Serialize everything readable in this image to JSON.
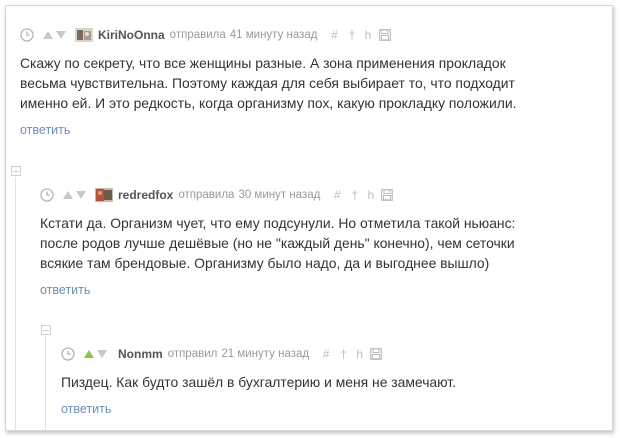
{
  "colors": {
    "link": "#6b8fb5",
    "vote_up_active": "#8cc152",
    "vote_inactive": "#c8c8c8",
    "meta": "#9a9a9a",
    "text": "#333333"
  },
  "icons": {
    "clock": "clock-icon",
    "vote_up": "triangle-up-icon",
    "vote_down": "triangle-down-icon",
    "hash": "hash-icon",
    "up": "up-arrow-icon",
    "branch": "branch-icon",
    "save": "floppy-disk-icon",
    "collapse": "minus-box-icon"
  },
  "comments": [
    {
      "username": "KiriNoOnna",
      "action": "отправила",
      "time": "41 минуту назад",
      "text": "Скажу по секрету, что все женщины разные. А зона применения прокладок\nвесьма чувствительна. Поэтому каждая для себя выбирает то, что подходит\nименно ей. И это редкость, когда организму пох, какую прокладку положили.",
      "reply": "ответить",
      "vote_up_active": false
    },
    {
      "username": "redredfox",
      "action": "отправила",
      "time": "30 минут назад",
      "text": "Кстати да. Организм чует, что ему подсунули. Но отметила такой ньюанс:\nпосле родов лучше дешёвые (но не \"каждый день\" конечно), чем сеточки\nвсякие там брендовые. Организму было надо, да и выгоднее вышло)",
      "reply": "ответить",
      "vote_up_active": false
    },
    {
      "username": "Nonmm",
      "action": "отправил",
      "time": "21 минуту назад",
      "text": "Пиздец. Как будто зашёл в бухгалтерию и меня не замечают.",
      "reply": "ответить",
      "vote_up_active": true
    }
  ],
  "symbols": {
    "hash": "#",
    "up": "†",
    "branch": "h"
  }
}
